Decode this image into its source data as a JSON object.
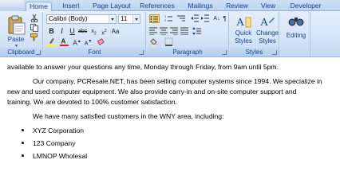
{
  "tabs": [
    "Home",
    "Insert",
    "Page Layout",
    "References",
    "Mailings",
    "Review",
    "View",
    "Developer"
  ],
  "ribbon": {
    "clipboard": {
      "paste_label": "Paste",
      "group_label": "Clipboard"
    },
    "font": {
      "font_name": "Calibri (Body)",
      "font_size": "11",
      "group_label": "Font"
    },
    "paragraph": {
      "group_label": "Paragraph"
    },
    "styles": {
      "quick_styles_line1": "Quick",
      "quick_styles_line2": "Styles",
      "change_styles_line1": "Change",
      "change_styles_line2": "Styles",
      "group_label": "Styles"
    },
    "editing": {
      "label": "Editing"
    }
  },
  "document": {
    "line1": "available to answer your questions any time, Monday through Friday, from 9am until 5pm.",
    "line2": "Our company, PCResale.NET, has been selling computer systems since 1994.  We specialize in",
    "line3": "new and used computer equipment. We also provide carry-in and on-site computer support and",
    "line4": "training. We are devoted to 100% customer satisfaction.",
    "line5": "We have many satisfied customers in the WNY area, including:",
    "bullets": [
      "XYZ Corporation",
      "123 Company",
      "LMNOP Wholesal"
    ]
  },
  "colors": {
    "highlight": "#ffff00",
    "font_color": "#e02020",
    "ribbon": "#d5e4f7",
    "accent_text": "#15428b"
  }
}
